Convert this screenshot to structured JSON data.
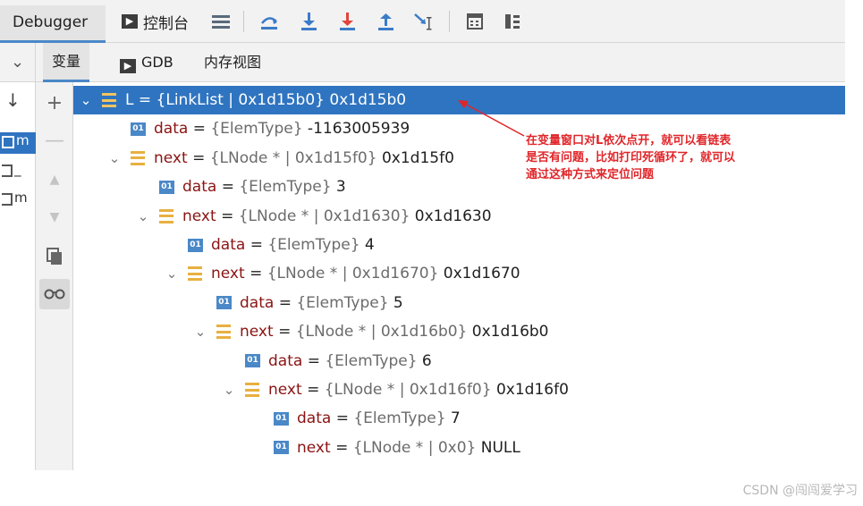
{
  "toolbar": {
    "debugger_tab": "Debugger",
    "console_label": "控制台",
    "console_icon": "▶",
    "buttons": [
      "menu-icon",
      "step-over-icon",
      "step-into-icon",
      "force-step-into-icon",
      "step-out-icon",
      "run-to-cursor-icon",
      "evaluate-icon",
      "frames-layout-icon"
    ]
  },
  "tabs": {
    "variables": "变量",
    "gdb": "GDB",
    "gdb_icon": "▶",
    "memory": "内存视图"
  },
  "frames": {
    "items": [
      "m",
      "_",
      "m"
    ]
  },
  "tree": {
    "rows": [
      {
        "expanded": true,
        "kind": "struct",
        "name": "L",
        "eq": " = ",
        "type": "{LinkList | 0x1d15b0}",
        "value": " 0x1d15b0",
        "selected": true
      },
      {
        "kind": "prim",
        "name": "data",
        "eq": " = ",
        "type": "{ElemType}",
        "value": " -1163005939"
      },
      {
        "expanded": true,
        "kind": "struct",
        "name": "next",
        "eq": " = ",
        "type": "{LNode * | 0x1d15f0}",
        "value": " 0x1d15f0"
      },
      {
        "kind": "prim",
        "name": "data",
        "eq": " = ",
        "type": "{ElemType}",
        "value": " 3"
      },
      {
        "expanded": true,
        "kind": "struct",
        "name": "next",
        "eq": " = ",
        "type": "{LNode * | 0x1d1630}",
        "value": " 0x1d1630"
      },
      {
        "kind": "prim",
        "name": "data",
        "eq": " = ",
        "type": "{ElemType}",
        "value": " 4"
      },
      {
        "expanded": true,
        "kind": "struct",
        "name": "next",
        "eq": " = ",
        "type": "{LNode * | 0x1d1670}",
        "value": " 0x1d1670"
      },
      {
        "kind": "prim",
        "name": "data",
        "eq": " = ",
        "type": "{ElemType}",
        "value": " 5"
      },
      {
        "expanded": true,
        "kind": "struct",
        "name": "next",
        "eq": " = ",
        "type": "{LNode * | 0x1d16b0}",
        "value": " 0x1d16b0"
      },
      {
        "kind": "prim",
        "name": "data",
        "eq": " = ",
        "type": "{ElemType}",
        "value": " 6"
      },
      {
        "expanded": true,
        "kind": "struct",
        "name": "next",
        "eq": " = ",
        "type": "{LNode * | 0x1d16f0}",
        "value": " 0x1d16f0"
      },
      {
        "kind": "prim",
        "name": "data",
        "eq": " = ",
        "type": "{ElemType}",
        "value": " 7"
      },
      {
        "kind": "prim",
        "name": "next",
        "eq": " = ",
        "type": "{LNode * | 0x0}",
        "value": " NULL"
      }
    ],
    "prim_badge": "01"
  },
  "annotation": {
    "lines": [
      "在变量窗口对L依次点开，就可以看链表",
      "是否有问题，比如打印死循环了，就可以",
      "通过这种方式来定位问题"
    ],
    "color": "#e0262a"
  },
  "watermark": "CSDN @闯闯爱学习",
  "colors": {
    "accent": "#2f74c0",
    "struct_icon": "#e8b040",
    "prim_icon": "#4a88c7",
    "var_name": "#8a1414"
  }
}
